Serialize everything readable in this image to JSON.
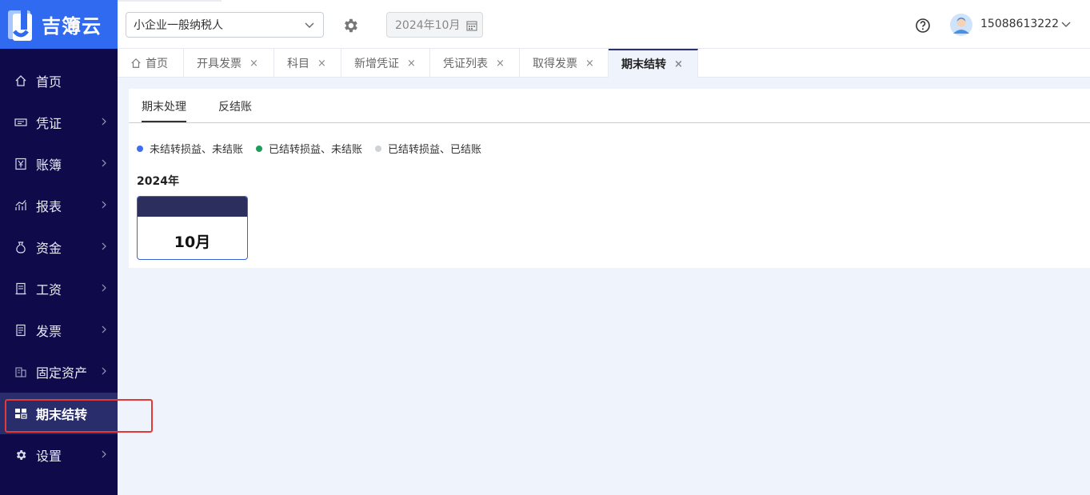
{
  "app": {
    "logo_text": "吉簿云"
  },
  "header": {
    "company_select_value": "小企业一般纳税人",
    "period_value": "2024年10月",
    "user_phone": "15088613222"
  },
  "sidebar": {
    "items": [
      {
        "label": "首页",
        "icon": "home-icon",
        "has_arrow": false
      },
      {
        "label": "凭证",
        "icon": "voucher-icon",
        "has_arrow": true
      },
      {
        "label": "账簿",
        "icon": "yen-icon",
        "has_arrow": true
      },
      {
        "label": "报表",
        "icon": "chart-icon",
        "has_arrow": true
      },
      {
        "label": "资金",
        "icon": "money-bag-icon",
        "has_arrow": true
      },
      {
        "label": "工资",
        "icon": "document-icon",
        "has_arrow": true
      },
      {
        "label": "发票",
        "icon": "invoice-icon",
        "has_arrow": true
      },
      {
        "label": "固定资产",
        "icon": "building-icon",
        "has_arrow": true
      },
      {
        "label": "期末结转",
        "icon": "closing-icon",
        "has_arrow": false,
        "active": true
      },
      {
        "label": "设置",
        "icon": "gear-icon",
        "has_arrow": true
      }
    ]
  },
  "tabs": [
    {
      "label": "首页",
      "closable": false
    },
    {
      "label": "开具发票",
      "closable": true
    },
    {
      "label": "科目",
      "closable": true
    },
    {
      "label": "新增凭证",
      "closable": true
    },
    {
      "label": "凭证列表",
      "closable": true
    },
    {
      "label": "取得发票",
      "closable": true
    },
    {
      "label": "期末结转",
      "closable": true,
      "active": true
    }
  ],
  "tab_close_glyph": "×",
  "main": {
    "subtabs": [
      "期末处理",
      "反结账"
    ],
    "legend": [
      {
        "label": "未结转损益、未结账",
        "color": "#3b6ff0"
      },
      {
        "label": "已结转损益、未结账",
        "color": "#1e9e5a"
      },
      {
        "label": "已结转损益、已结账",
        "color": "#cfd2d6"
      }
    ],
    "year": "2024年",
    "months": [
      {
        "label": "10月",
        "header_color": "#2c2f5e"
      }
    ]
  },
  "colors": {
    "sidebar_bg": "#0f0b4b",
    "logo_bg": "#2f6af0",
    "active_nav_bg": "#2a2d6c",
    "highlight_border": "#e53935"
  }
}
